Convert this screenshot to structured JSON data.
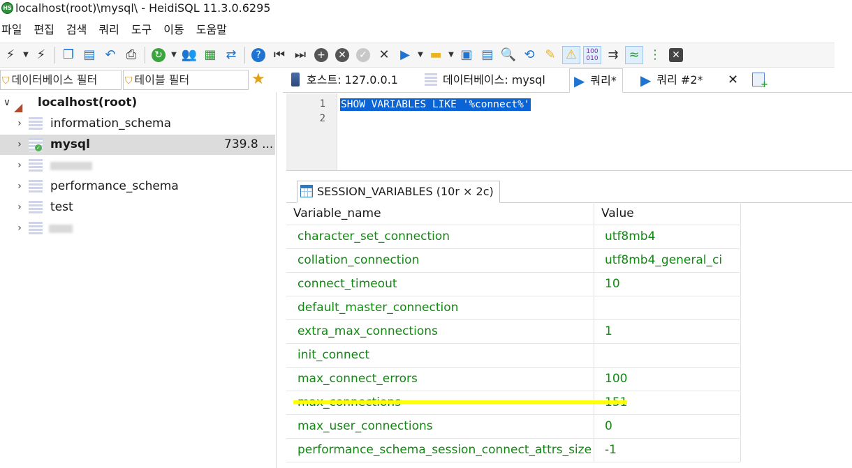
{
  "window": {
    "title": "localhost(root)\\mysql\\ - HeidiSQL 11.3.0.6295",
    "app_icon_label": "HS"
  },
  "menu": [
    "파일",
    "편집",
    "검색",
    "쿼리",
    "도구",
    "이동",
    "도움말"
  ],
  "filters": {
    "database_filter": "데이터베이스 필터",
    "table_filter": "테이블 필터"
  },
  "tree": {
    "server": "localhost(root)",
    "databases": [
      {
        "name": "information_schema",
        "size": ""
      },
      {
        "name": "mysql",
        "size": "739.8 ...",
        "selected": true
      },
      {
        "name": "",
        "size": "",
        "obscured": true
      },
      {
        "name": "performance_schema",
        "size": ""
      },
      {
        "name": "test",
        "size": ""
      },
      {
        "name": "",
        "size": "",
        "obscured": true
      }
    ]
  },
  "tabs": {
    "host": "호스트: 127.0.0.1",
    "database": "데이터베이스: mysql",
    "query": "쿼리*",
    "query2": "쿼리 #2*",
    "close": "✕"
  },
  "editor": {
    "line_numbers": [
      "1",
      "2"
    ],
    "code": "SHOW VARIABLES LIKE '%connect%'"
  },
  "results": {
    "tab_label": "SESSION_VARIABLES (10r × 2c)",
    "columns": [
      "Variable_name",
      "Value"
    ],
    "rows": [
      [
        "character_set_connection",
        "utf8mb4"
      ],
      [
        "collation_connection",
        "utf8mb4_general_ci"
      ],
      [
        "connect_timeout",
        "10"
      ],
      [
        "default_master_connection",
        ""
      ],
      [
        "extra_max_connections",
        "1"
      ],
      [
        "init_connect",
        ""
      ],
      [
        "max_connect_errors",
        "100"
      ],
      [
        "max_connections",
        "151"
      ],
      [
        "max_user_connections",
        "0"
      ],
      [
        "performance_schema_session_connect_attrs_size",
        "-1"
      ]
    ],
    "highlight_color": "#ffff00"
  },
  "colors": {
    "accent": "#1e74d0",
    "cell_text": "#128a12",
    "selection": "#0a64d6"
  }
}
